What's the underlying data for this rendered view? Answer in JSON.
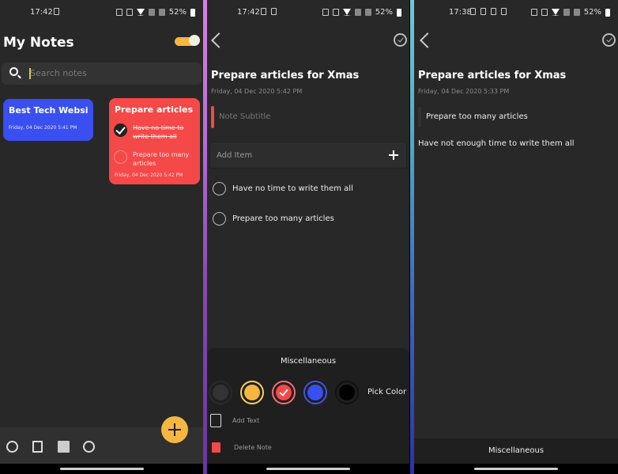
{
  "screens": [
    {
      "status": {
        "time": "17:42",
        "battery": "52%"
      },
      "header": {
        "title": "My Notes",
        "theme_toggle_on": true
      },
      "search": {
        "placeholder": "Search notes",
        "value": ""
      },
      "notes": [
        {
          "title": "Best Tech Websit...",
          "date": "Friday, 04 Dec 2020 5:41 PM",
          "color": "#3a4ff0"
        },
        {
          "title": "Prepare articles ...",
          "date": "Friday, 04 Dec 2020 5:42 PM",
          "color": "#f54848",
          "items": [
            {
              "text": "Have no time to write them all",
              "checked": true
            },
            {
              "text": "Prepare too many articles",
              "checked": false
            }
          ]
        }
      ],
      "bottom_bar": {
        "icons": [
          "add-circle-icon",
          "checklist-icon",
          "image-icon",
          "globe-icon"
        ]
      },
      "fab": {
        "icon": "plus-icon",
        "color": "#f5b642"
      }
    },
    {
      "status": {
        "time": "17:42",
        "battery": "52%"
      },
      "note": {
        "title": "Prepare articles for Xmas",
        "date": "Friday, 04 Dec 2020 5:42 PM",
        "subtitle_placeholder": "Note Subtitle",
        "add_item_label": "Add Item",
        "items": [
          {
            "text": "Have no time to write them all",
            "checked": false
          },
          {
            "text": "Prepare too many articles",
            "checked": false
          }
        ]
      },
      "sheet": {
        "title": "Miscellaneous",
        "colors": [
          {
            "name": "dark",
            "fill": "#333333",
            "ring": "#2a2a2a",
            "selected": false
          },
          {
            "name": "yellow",
            "fill": "#f5b642",
            "ring": "#f5d060",
            "selected": false
          },
          {
            "name": "red",
            "fill": "#f54848",
            "ring": "#f07070",
            "selected": true
          },
          {
            "name": "blue",
            "fill": "#3a4ff0",
            "ring": "#4055e0",
            "selected": false
          },
          {
            "name": "black",
            "fill": "#000000",
            "ring": "#111111",
            "selected": false
          }
        ],
        "pick_color_label": "Pick Color",
        "add_text_label": "Add Text",
        "delete_note_label": "Delete Note"
      }
    },
    {
      "status": {
        "time": "17:38",
        "battery": "52%"
      },
      "note": {
        "title": "Prepare articles for Xmas",
        "date": "Friday, 04 Dec 2020 5:33 PM",
        "subtitle": "Prepare too many articles",
        "body": "Have not enough time to write them all"
      },
      "sheet": {
        "title": "Miscellaneous"
      }
    }
  ]
}
